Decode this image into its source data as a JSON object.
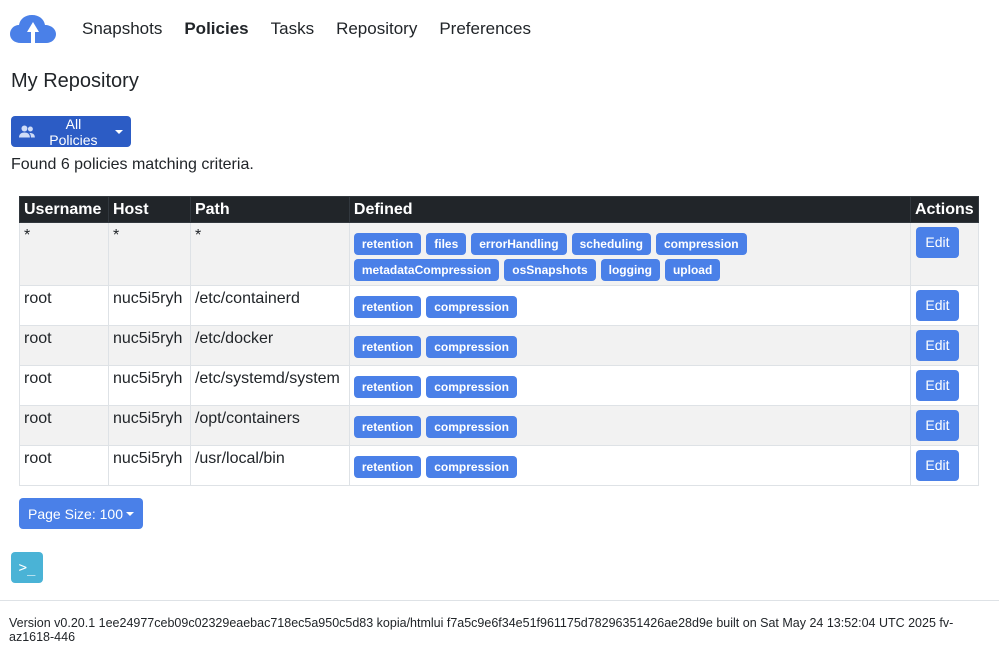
{
  "nav": {
    "items": [
      {
        "label": "Snapshots",
        "active": false
      },
      {
        "label": "Policies",
        "active": true
      },
      {
        "label": "Tasks",
        "active": false
      },
      {
        "label": "Repository",
        "active": false
      },
      {
        "label": "Preferences",
        "active": false
      }
    ]
  },
  "page": {
    "title": "My Repository",
    "filter_label": "All Policies",
    "found_text": "Found 6 policies matching criteria."
  },
  "table": {
    "headers": [
      "Username",
      "Host",
      "Path",
      "Defined",
      "Actions"
    ],
    "rows": [
      {
        "username": "*",
        "host": "*",
        "path": "*",
        "defined": [
          "retention",
          "files",
          "errorHandling",
          "scheduling",
          "compression",
          "metadataCompression",
          "osSnapshots",
          "logging",
          "upload"
        ],
        "action": "Edit"
      },
      {
        "username": "root",
        "host": "nuc5i5ryh",
        "path": "/etc/containerd",
        "defined": [
          "retention",
          "compression"
        ],
        "action": "Edit"
      },
      {
        "username": "root",
        "host": "nuc5i5ryh",
        "path": "/etc/docker",
        "defined": [
          "retention",
          "compression"
        ],
        "action": "Edit"
      },
      {
        "username": "root",
        "host": "nuc5i5ryh",
        "path": "/etc/systemd/system",
        "defined": [
          "retention",
          "compression"
        ],
        "action": "Edit"
      },
      {
        "username": "root",
        "host": "nuc5i5ryh",
        "path": "/opt/containers",
        "defined": [
          "retention",
          "compression"
        ],
        "action": "Edit"
      },
      {
        "username": "root",
        "host": "nuc5i5ryh",
        "path": "/usr/local/bin",
        "defined": [
          "retention",
          "compression"
        ],
        "action": "Edit"
      }
    ]
  },
  "pagination": {
    "page_size_label": "Page Size: 100"
  },
  "terminal": {
    "glyph": ">_"
  },
  "footer": {
    "version_text": "Version v0.20.1 1ee24977ceb09c02329eaebac718ec5a950c5d83 kopia/htmlui f7a5c9e6f34e51f961175d78296351426ae28d9e built on Sat May 24 13:52:04 UTC 2025 fv-az1618-446"
  },
  "colors": {
    "brand": "#4a80e8",
    "brand_dark": "#2c5cc5",
    "table_header": "#212529",
    "terminal": "#4ab3d6"
  }
}
